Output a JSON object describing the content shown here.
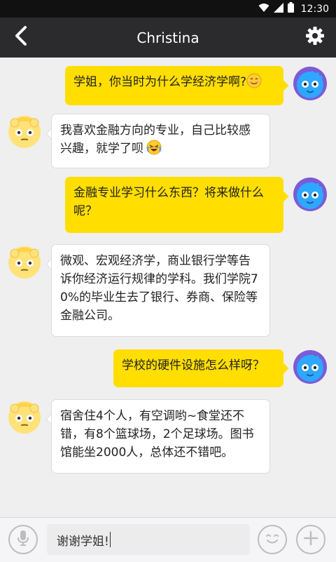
{
  "status_bar": {
    "time": "12:30",
    "icons": [
      "wifi-icon",
      "signal-icon",
      "battery-icon"
    ]
  },
  "header": {
    "title": "Christina",
    "left_icon": "back-icon",
    "right_icon": "gear-icon"
  },
  "messages": [
    {
      "side": "out",
      "text": "学姐，你当时为什么学经济学啊?",
      "emoji": "smile-emoji"
    },
    {
      "side": "in",
      "text": "我喜欢金融方向的专业，自己比较感兴趣，就学了呗",
      "emoji": "laugh-cry-emoji"
    },
    {
      "side": "out",
      "text": "金融专业学习什么东西？将来做什么呢？"
    },
    {
      "side": "in",
      "text": "微观、宏观经济学，商业银行学等告诉你经济运行规律的学科。我们学院70%的毕业生去了银行、券商、保险等金融公司。"
    },
    {
      "side": "out",
      "text": "学校的硬件设施怎么样呀？"
    },
    {
      "side": "in",
      "text": "宿舍住4个人，有空调哟~食堂还不错，有8个篮球场，2个足球场。图书馆能坐2000人，总体还不错吧。"
    }
  ],
  "composer": {
    "value": "谢谢学姐!",
    "left_icon": "microphone-icon",
    "emoji_icon": "emoji-face-icon",
    "add_icon": "plus-icon"
  },
  "colors": {
    "header_bg": "#2b2b2e",
    "outgoing_bubble": "#ffde00",
    "incoming_bubble": "#ffffff",
    "chat_bg": "#efeff0"
  }
}
